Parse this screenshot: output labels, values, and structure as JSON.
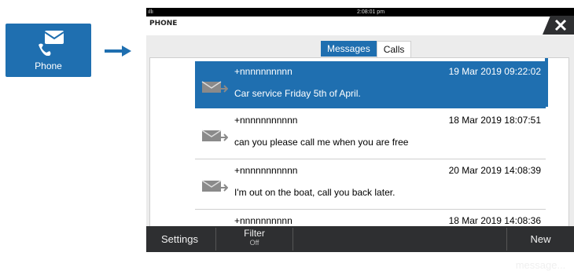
{
  "tile": {
    "label": "Phone"
  },
  "status": {
    "signal": "ıllı",
    "time": "2:08:01 pm"
  },
  "header": {
    "title": "PHONE"
  },
  "tabs": [
    {
      "label": "Messages"
    },
    {
      "label": "Calls"
    }
  ],
  "messages": [
    {
      "sender": "+nnnnnnnnnn",
      "date": "19 Mar 2019 09:22:02",
      "text": "Car service Friday 5th of April."
    },
    {
      "sender": "+nnnnnnnnnnn",
      "date": "18 Mar 2019 18:07:51",
      "text": "can you please call me when you are free"
    },
    {
      "sender": "+nnnnnnnnnnn",
      "date": "20 Mar 2019 14:08:39",
      "text": "I'm out on the boat, call you back later."
    },
    {
      "sender": "+nnnnnnnnnn",
      "date": "18 Mar 2019 14:08:36",
      "text": ""
    }
  ],
  "toolbar": {
    "settings": "Settings",
    "filter": "Filter",
    "filter_state": "Off",
    "new_message": "New message..."
  },
  "colors": {
    "accent": "#1f6fb0",
    "toolbar": "#2e2f31"
  }
}
